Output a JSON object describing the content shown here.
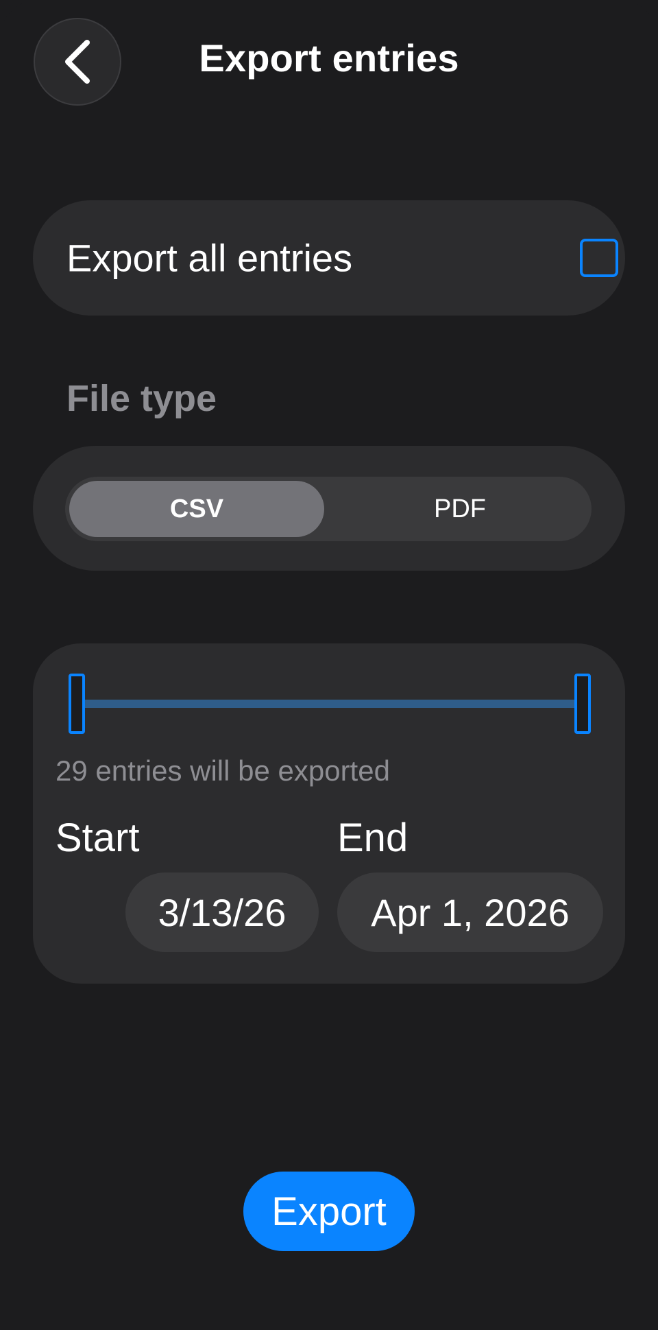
{
  "header": {
    "title": "Export entries",
    "back_icon": "chevron-left-icon"
  },
  "export_all": {
    "label": "Export all entries",
    "checked": false
  },
  "file_type": {
    "label": "File type",
    "options": [
      "CSV",
      "PDF"
    ],
    "selected": "CSV"
  },
  "range": {
    "count_text": "29 entries will be exported",
    "start_label": "Start",
    "start_value": "3/13/26",
    "end_label": "End",
    "end_value": "Apr 1, 2026",
    "slider_start_fraction": 0.0,
    "slider_end_fraction": 1.0
  },
  "actions": {
    "export_label": "Export"
  },
  "colors": {
    "accent": "#0a84ff",
    "background": "#1c1c1e",
    "card": "#2c2c2e",
    "secondary_text": "#8e8e93"
  }
}
